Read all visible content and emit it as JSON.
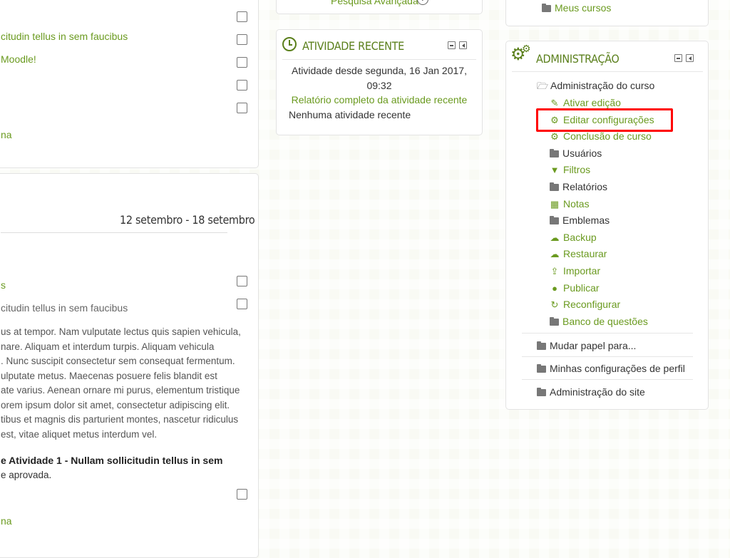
{
  "left_top": {
    "line1": "citudin tellus in sem faucibus",
    "line2": "Moodle!",
    "line3": "na"
  },
  "week": {
    "title": "12 setembro - 18 setembro",
    "item1": "s",
    "item2": "citudin tellus in sem faucibus",
    "paragraph": [
      "us at tempor. Nam vulputate lectus quis sapien vehicula,",
      "nare. Aliquam et interdum turpis. Aliquam vehicula",
      ". Nunc suscipit consectetur sem consequat fermentum.",
      "ulputate metus. Maecenas posuere felis blandit est",
      "ate varius. Aenean ornare mi purus, elementum tristique",
      "orem ipsum dolor sit amet, consectetur adipiscing elit.",
      "tibus et magnis dis parturient montes, nascetur ridiculus",
      "est, vitae aliquet metus interdum vel."
    ],
    "bold_line": "e Atividade 1 - Nullam sollicitudin tellus in sem",
    "approved": "e aprovada.",
    "bottom_link": "na"
  },
  "search": {
    "advanced": "Pesquisa Avançada"
  },
  "recent": {
    "title": "ATIVIDADE RECENTE",
    "since_line1": "Atividade desde segunda, 16 Jan 2017,",
    "since_line2": "09:32",
    "report_link": "Relatório completo da atividade recente",
    "none": "Nenhuma atividade recente"
  },
  "navigation": {
    "my_courses": "Meus cursos"
  },
  "admin": {
    "title": "ADMINISTRAÇÃO",
    "course_admin": "Administração do curso",
    "items": [
      {
        "label": "Ativar edição",
        "icon": "pencil-icon"
      },
      {
        "label": "Editar configurações",
        "icon": "cogs-icon"
      },
      {
        "label": "Conclusão de curso",
        "icon": "cogs-icon"
      },
      {
        "label": "Usuários",
        "icon": "folder-icon"
      },
      {
        "label": "Filtros",
        "icon": "filter-icon"
      },
      {
        "label": "Relatórios",
        "icon": "folder-icon"
      },
      {
        "label": "Notas",
        "icon": "table-icon"
      },
      {
        "label": "Emblemas",
        "icon": "folder-icon"
      },
      {
        "label": "Backup",
        "icon": "cloud-upload-icon"
      },
      {
        "label": "Restaurar",
        "icon": "cloud-upload-icon"
      },
      {
        "label": "Importar",
        "icon": "upload-icon"
      },
      {
        "label": "Publicar",
        "icon": "globe-icon"
      },
      {
        "label": "Reconfigurar",
        "icon": "refresh-icon"
      },
      {
        "label": "Banco de questões",
        "icon": "folder-icon"
      }
    ],
    "switch_role": "Mudar papel para...",
    "profile_settings": "Minhas configurações de perfil",
    "site_admin": "Administração do site"
  },
  "colors": {
    "accent": "#6a9a1f",
    "title": "#5a7f1b",
    "highlight": "#ff0000"
  }
}
